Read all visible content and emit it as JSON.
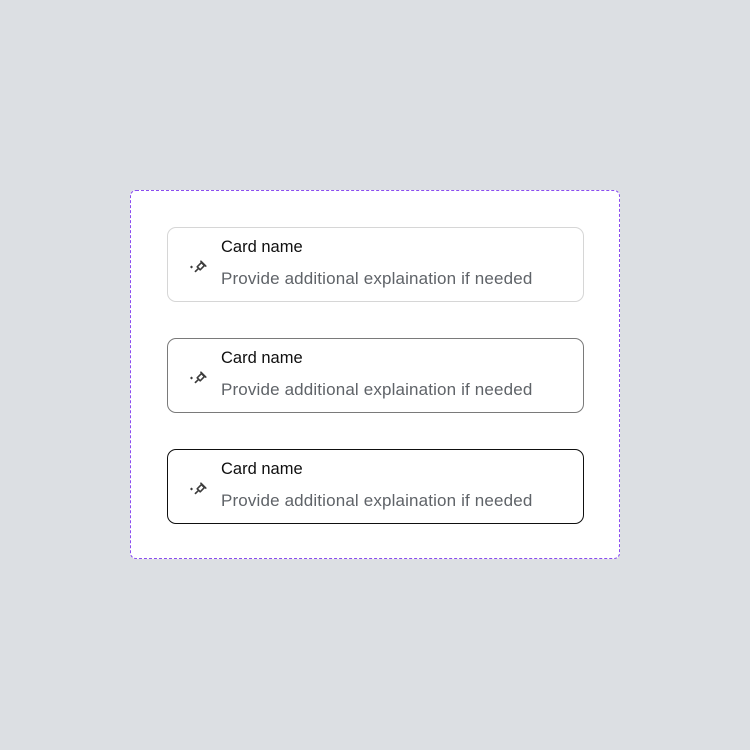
{
  "cards": [
    {
      "state": "default",
      "icon": "sparkle-pin-icon",
      "title": "Card name",
      "description": "Provide additional explaination if needed"
    },
    {
      "state": "hover",
      "icon": "sparkle-pin-icon",
      "title": "Card name",
      "description": "Provide additional explaination if needed"
    },
    {
      "state": "selected",
      "icon": "sparkle-pin-icon",
      "title": "Card name",
      "description": "Provide additional explaination if needed"
    }
  ],
  "colors": {
    "background": "#dcdfe3",
    "frame_border": "#8a4cf0",
    "card_border_default": "#d6d6d6",
    "card_border_hover": "#7a7a7a",
    "card_border_selected": "#0f0f0f",
    "title": "#0f0f0f",
    "description": "#5f6368"
  }
}
